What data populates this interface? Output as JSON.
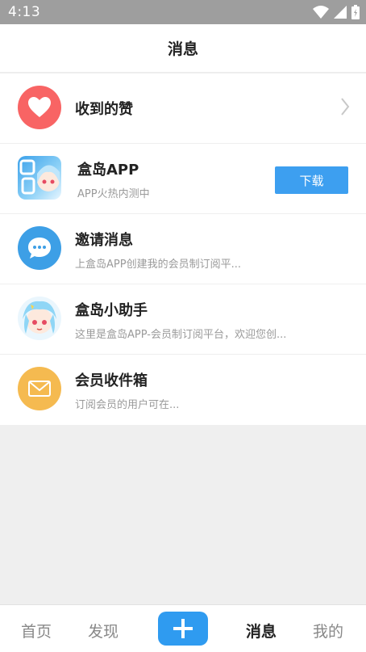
{
  "status_bar": {
    "time": "4:13"
  },
  "header": {
    "title": "消息"
  },
  "messages": [
    {
      "title": "收到的赞",
      "subtitle": "",
      "icon": "heart-icon",
      "color": "#f86464"
    },
    {
      "title": "盒岛APP",
      "subtitle": "APP火热内测中",
      "icon": "app-logo-icon",
      "action_label": "下载"
    },
    {
      "title": "邀请消息",
      "subtitle": "上盒岛APP创建我的会员制订阅平...",
      "icon": "chat-bubble-icon",
      "color": "#3d9fe6"
    },
    {
      "title": "盒岛小助手",
      "subtitle": "这里是盒岛APP-会员制订阅平台，欢迎您创...",
      "icon": "assistant-avatar-icon"
    },
    {
      "title": "会员收件箱",
      "subtitle": "订阅会员的用户可在...",
      "icon": "envelope-icon",
      "color": "#f5ba50"
    }
  ],
  "bottom_nav": {
    "home": "首页",
    "discover": "发现",
    "messages": "消息",
    "mine": "我的",
    "active": "messages"
  },
  "colors": {
    "accent": "#2f9bf0",
    "status_bar": "#9e9e9e"
  }
}
